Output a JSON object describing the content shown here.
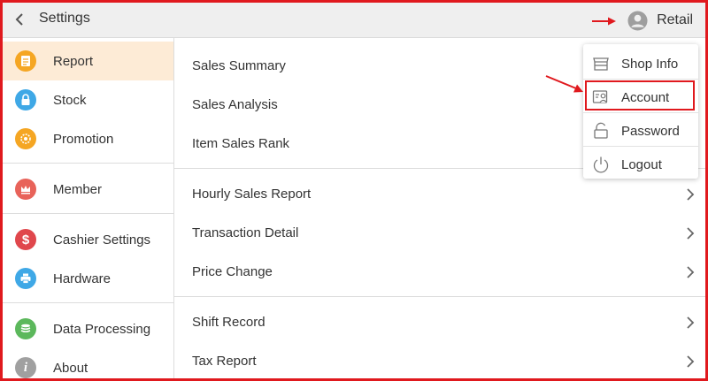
{
  "header": {
    "title": "Settings",
    "user_name": "Retail"
  },
  "sidebar": {
    "items": [
      {
        "label": "Report",
        "icon": "report-icon",
        "color": "#f5a623"
      },
      {
        "label": "Stock",
        "icon": "lock-icon",
        "color": "#3fa8e6"
      },
      {
        "label": "Promotion",
        "icon": "promotion-icon",
        "color": "#f5a623"
      },
      {
        "label": "Member",
        "icon": "crown-icon",
        "color": "#e8635a"
      },
      {
        "label": "Cashier Settings",
        "icon": "dollar-icon",
        "color": "#e0474c"
      },
      {
        "label": "Hardware",
        "icon": "printer-icon",
        "color": "#3fa8e6"
      },
      {
        "label": "Data Processing",
        "icon": "database-icon",
        "color": "#5cb85c"
      },
      {
        "label": "About",
        "icon": "info-icon",
        "color": "#a0a0a0"
      }
    ],
    "active_color": "#fdebd6"
  },
  "main": {
    "items": [
      {
        "label": "Sales Summary"
      },
      {
        "label": "Sales Analysis"
      },
      {
        "label": "Item Sales Rank"
      },
      {
        "label": "Hourly Sales Report"
      },
      {
        "label": "Transaction Detail"
      },
      {
        "label": "Price Change"
      },
      {
        "label": "Shift Record"
      },
      {
        "label": "Tax Report"
      }
    ]
  },
  "dropdown": {
    "items": [
      {
        "label": "Shop Info",
        "icon": "shop-icon"
      },
      {
        "label": "Account",
        "icon": "account-card-icon"
      },
      {
        "label": "Password",
        "icon": "unlock-icon"
      },
      {
        "label": "Logout",
        "icon": "power-icon"
      }
    ]
  },
  "colors": {
    "accent_red": "#e0191e",
    "topbar_bg": "#efefef"
  }
}
